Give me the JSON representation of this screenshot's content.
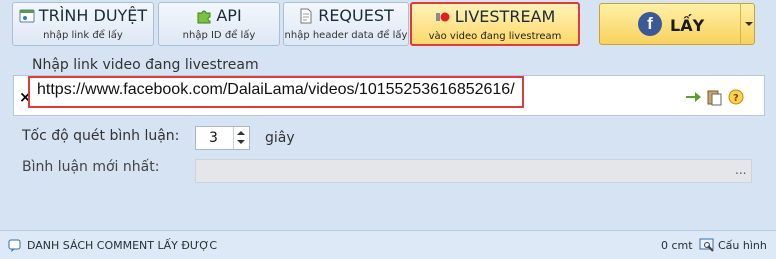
{
  "toolbar": {
    "tabs": [
      {
        "title": "TRÌNH DUYỆT",
        "sub": "nhập link để lấy",
        "icon": "browser-icon"
      },
      {
        "title": "API",
        "sub": "nhập ID để lấy",
        "icon": "puzzle-icon"
      },
      {
        "title": "REQUEST",
        "sub": "nhập header data để lấy",
        "icon": "document-icon"
      },
      {
        "title": "LIVESTREAM",
        "sub": "vào video đang livestream",
        "icon": "record-icon",
        "active": true
      }
    ],
    "get_label": "LẤY",
    "get_icon": "facebook-icon"
  },
  "form": {
    "link_label": "Nhập link video đang livestream",
    "url_value": "https://www.facebook.com/DalaiLama/videos/10155253616852616/",
    "speed_label": "Tốc độ quét bình luận:",
    "speed_value": "3",
    "speed_unit": "giây",
    "latest_label": "Bình luận mới nhất:",
    "latest_more": "..."
  },
  "bottom": {
    "title": "DANH SÁCH COMMENT LẤY ĐƯỢC",
    "count": "0 cmt",
    "config_label": "Cấu hình"
  },
  "colors": {
    "active_border": "#e03a3a",
    "active_fill": "#ffd86a",
    "background": "#d6e3f3",
    "facebook": "#3b5998"
  }
}
